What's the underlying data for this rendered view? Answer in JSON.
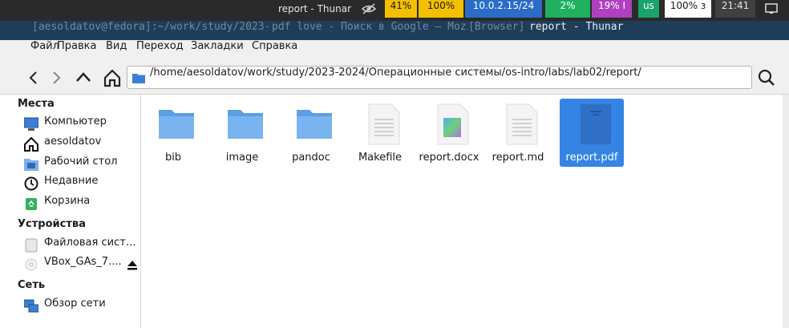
{
  "status_bar": {
    "window_title": "report - Thunar",
    "segments": [
      {
        "text": "41%",
        "bg": "#f3c000",
        "fg": "#1a1a1a"
      },
      {
        "text": "100%",
        "bg": "#f3c000",
        "fg": "#1a1a1a"
      },
      {
        "text": "10.0.2.15/24",
        "bg": "#2a6cc7",
        "fg": "#ffffff"
      },
      {
        "text": "2%",
        "bg": "#1fb060",
        "fg": "#ffffff"
      },
      {
        "text": "19% I",
        "bg": "#b040c0",
        "fg": "#ffffff"
      },
      {
        "text": "us",
        "bg": "#1aa36a",
        "fg": "#ffffff"
      },
      {
        "text": "100% з",
        "bg": "#ffffff",
        "fg": "#1a1a1a"
      },
      {
        "text": "21:41",
        "bg": "#404040",
        "fg": "#e6e6e6"
      }
    ]
  },
  "taskbar": {
    "tasks": [
      {
        "label": "[aesoldatov@fedora]:~/work/study/2023-2",
        "active": false
      },
      {
        "label": "pdf love - Поиск в Google — Mozi",
        "active": false
      },
      {
        "label": "[Browser]",
        "active": false
      },
      {
        "label": "report - Thunar",
        "active": true
      }
    ]
  },
  "menubar": {
    "items": [
      "Файл",
      "Правка",
      "Вид",
      "Переход",
      "Закладки",
      "Справка"
    ]
  },
  "toolbar": {
    "path": "/home/aesoldatov/work/study/2023-2024/Операционные системы/os-intro/labs/lab02/report/"
  },
  "sidebar": {
    "sections": [
      {
        "title": "Места",
        "items": [
          {
            "label": "Компьютер",
            "icon": "computer-icon"
          },
          {
            "label": "aesoldatov",
            "icon": "home-icon"
          },
          {
            "label": "Рабочий стол",
            "icon": "desktop-folder-icon"
          },
          {
            "label": "Недавние",
            "icon": "clock-icon"
          },
          {
            "label": "Корзина",
            "icon": "trash-icon"
          }
        ]
      },
      {
        "title": "Устройства",
        "items": [
          {
            "label": "Файловая систе...",
            "icon": "drive-icon"
          },
          {
            "label": "VBox_GAs_7....",
            "icon": "disc-icon"
          }
        ]
      },
      {
        "title": "Сеть",
        "items": [
          {
            "label": "Обзор сети",
            "icon": "network-icon"
          }
        ]
      }
    ]
  },
  "files": [
    {
      "name": "bib",
      "type": "folder"
    },
    {
      "name": "image",
      "type": "folder"
    },
    {
      "name": "pandoc",
      "type": "folder"
    },
    {
      "name": "Makefile",
      "type": "text"
    },
    {
      "name": "report.docx",
      "type": "docx"
    },
    {
      "name": "report.md",
      "type": "text"
    },
    {
      "name": "report.pdf",
      "type": "pdf",
      "selected": true
    }
  ]
}
